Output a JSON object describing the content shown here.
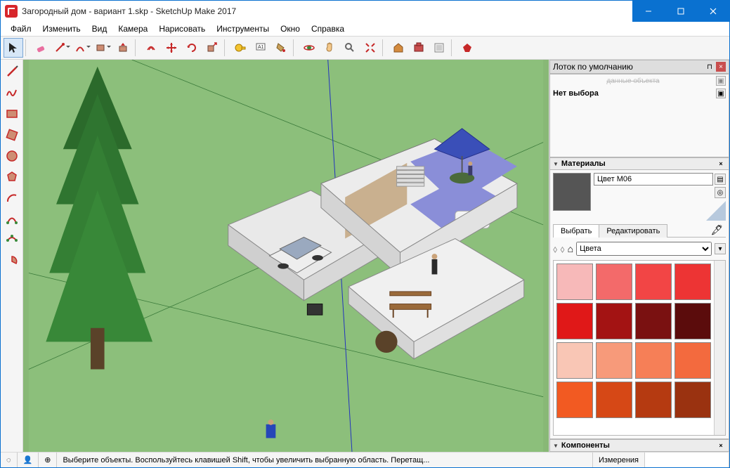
{
  "window": {
    "title": "Загородный дом - вариант 1.skp - SketchUp Make 2017"
  },
  "menu": {
    "items": [
      "Файл",
      "Изменить",
      "Вид",
      "Камера",
      "Нарисовать",
      "Инструменты",
      "Окно",
      "Справка"
    ]
  },
  "tray": {
    "title": "Лоток по умолчанию",
    "entity_panel_cut": "данные объекта",
    "no_selection": "Нет выбора",
    "materials": {
      "title": "Материалы",
      "name": "Цвет M06",
      "tabs": {
        "select": "Выбрать",
        "edit": "Редактировать"
      },
      "library": "Цвета",
      "swatches": [
        "#f7b9b9",
        "#f36a6a",
        "#f24545",
        "#ed3434",
        "#e01818",
        "#a31313",
        "#7a1111",
        "#5b0c0c",
        "#f9c6b5",
        "#f79a7a",
        "#f67f57",
        "#f36a3e",
        "#f25a22",
        "#d64816",
        "#b53a11",
        "#9a3210"
      ]
    },
    "components": {
      "title": "Компоненты"
    }
  },
  "status": {
    "hint": "Выберите объекты. Воспользуйтесь клавишей Shift, чтобы увеличить выбранную область. Перетащ...",
    "measure_label": "Измерения"
  }
}
